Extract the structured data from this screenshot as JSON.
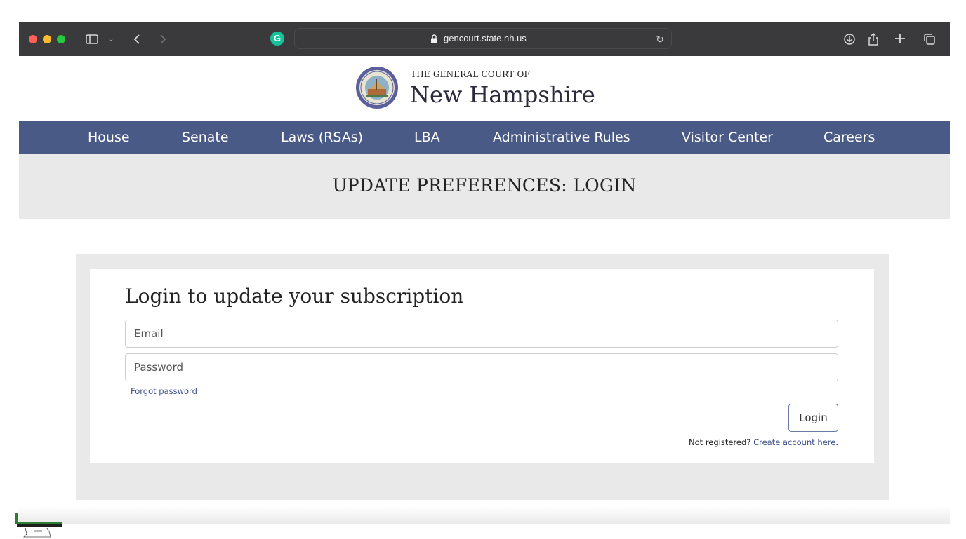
{
  "browser": {
    "url": "gencourt.state.nh.us",
    "icons": {
      "sidebar": "sidebar-icon",
      "chevron": "chevron-down-icon",
      "back": "back-arrow-icon",
      "forward": "forward-arrow-icon",
      "extension": "grammarly-icon",
      "lock": "lock-icon",
      "reload": "reload-icon",
      "download": "download-icon",
      "share": "share-icon",
      "new_tab": "plus-icon",
      "tab_overview": "tabs-icon"
    },
    "extension_letter": "G"
  },
  "header": {
    "title_small": "THE GENERAL COURT OF",
    "title_big": "New Hampshire"
  },
  "nav": {
    "items": [
      {
        "label": "House"
      },
      {
        "label": "Senate"
      },
      {
        "label": "Laws (RSAs)"
      },
      {
        "label": "LBA"
      },
      {
        "label": "Administrative Rules"
      },
      {
        "label": "Visitor Center"
      },
      {
        "label": "Careers"
      }
    ]
  },
  "banner": {
    "title": "UPDATE PREFERENCES: LOGIN"
  },
  "login": {
    "heading": "Login to update your subscription",
    "email_placeholder": "Email",
    "password_placeholder": "Password",
    "forgot_label": "Forgot password",
    "login_label": "Login",
    "not_registered": "Not registered?",
    "create_account": "Create account here",
    "period": "."
  },
  "colors": {
    "nav_bg": "#4a5a87",
    "banner_bg": "#e9e9e9",
    "link": "#3b4f8a",
    "toolbar_bg": "#3a3a3c"
  }
}
